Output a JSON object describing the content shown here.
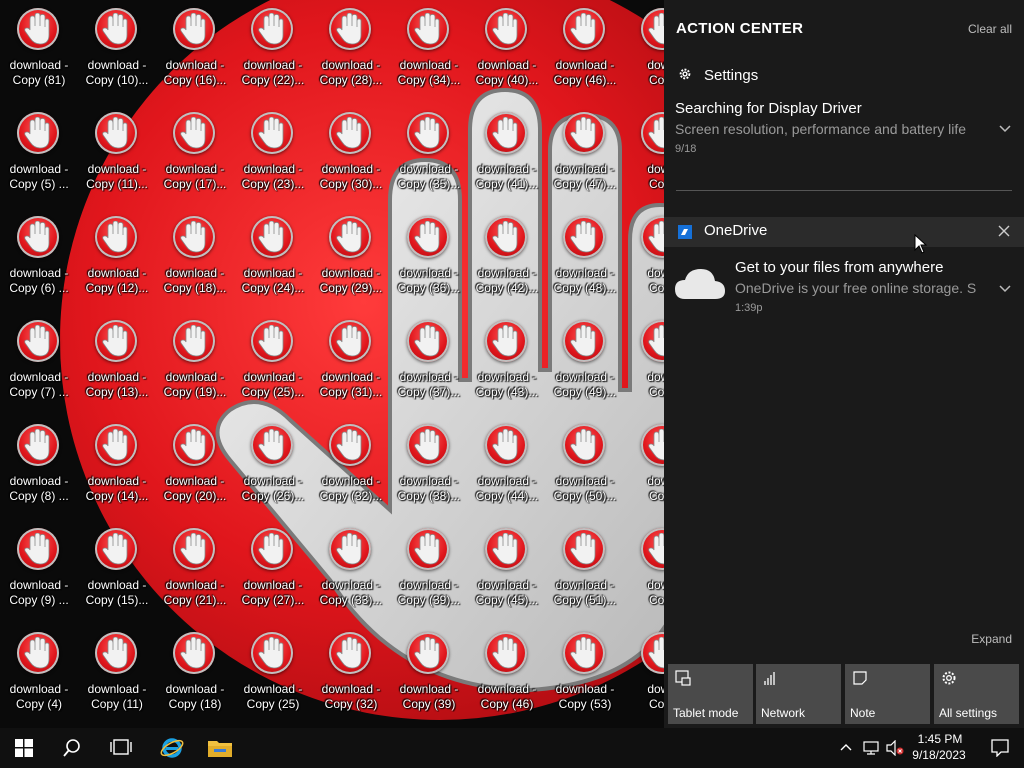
{
  "desktop": {
    "icons": [
      [
        "download - Copy (81)",
        "download - Copy (5) ...",
        "download - Copy (6) ...",
        "download - Copy (7) ...",
        "download - Copy (8) ...",
        "download - Copy (9) ...",
        "download - Copy (4)"
      ],
      [
        "download - Copy (10)...",
        "download - Copy (11)...",
        "download - Copy (12)...",
        "download - Copy (13)...",
        "download - Copy (14)...",
        "download - Copy (15)...",
        "download - Copy (11)"
      ],
      [
        "download - Copy (16)...",
        "download - Copy (17)...",
        "download - Copy (18)...",
        "download - Copy (19)...",
        "download - Copy (20)...",
        "download - Copy (21)...",
        "download - Copy (18)"
      ],
      [
        "download - Copy (22)...",
        "download - Copy (23)...",
        "download - Copy (24)...",
        "download - Copy (25)...",
        "download - Copy (26)...",
        "download - Copy (27)...",
        "download - Copy (25)"
      ],
      [
        "download - Copy (28)...",
        "download - Copy (30)...",
        "download - Copy (29)...",
        "download - Copy (31)...",
        "download - Copy (32)...",
        "download - Copy (33)...",
        "download - Copy (32)"
      ],
      [
        "download - Copy (34)...",
        "download - Copy (35)...",
        "download - Copy (36)...",
        "download - Copy (37)...",
        "download - Copy (38)...",
        "download - Copy (39)...",
        "download - Copy (39)"
      ],
      [
        "download - Copy (40)...",
        "download - Copy (41)...",
        "download - Copy (42)...",
        "download - Copy (43)...",
        "download - Copy (44)...",
        "download - Copy (45)...",
        "download - Copy (46)"
      ],
      [
        "download - Copy (46)...",
        "download - Copy (47)...",
        "download - Copy (48)...",
        "download - Copy (49)...",
        "download - Copy (50)...",
        "download - Copy (51)...",
        "download - Copy (53)"
      ],
      [
        "downl Copy",
        "downl Copy",
        "downl Copy",
        "downl Copy",
        "downl Copy",
        "downl Copy",
        "downl Copy"
      ]
    ]
  },
  "action_center": {
    "title": "ACTION CENTER",
    "clear_all": "Clear all",
    "settings_group": {
      "app_name": "Settings",
      "icon": "gear-icon",
      "notification": {
        "title": "Searching for Display Driver",
        "body": "Screen resolution, performance and battery life",
        "time": "9/18"
      }
    },
    "onedrive_group": {
      "app_name": "OneDrive",
      "icon": "onedrive-icon",
      "notification": {
        "title": "Get to your files from anywhere",
        "body": "OneDrive is your free online storage. S",
        "time": "1:39p"
      }
    },
    "expand": "Expand",
    "quick_actions": [
      {
        "label": "Tablet mode",
        "icon": "tablet-mode-icon"
      },
      {
        "label": "Network",
        "icon": "network-icon"
      },
      {
        "label": "Note",
        "icon": "note-icon"
      },
      {
        "label": "All settings",
        "icon": "gear-icon"
      }
    ]
  },
  "taskbar": {
    "time": "1:45 PM",
    "date": "9/18/2023",
    "pinned": [
      {
        "name": "start",
        "icon": "windows-logo-icon"
      },
      {
        "name": "search",
        "icon": "search-icon"
      },
      {
        "name": "task-view",
        "icon": "task-view-icon"
      },
      {
        "name": "internet-explorer",
        "icon": "internet-explorer-icon"
      },
      {
        "name": "file-explorer",
        "icon": "folder-icon"
      }
    ]
  },
  "colors": {
    "wallpaper_red": "#e0161c",
    "action_center_bg": "#1c1c1c",
    "tile_bg": "#4a4a4a",
    "taskbar_bg": "#101010",
    "ie_blue": "#1ba1e2",
    "folder_yellow": "#f0c040"
  }
}
